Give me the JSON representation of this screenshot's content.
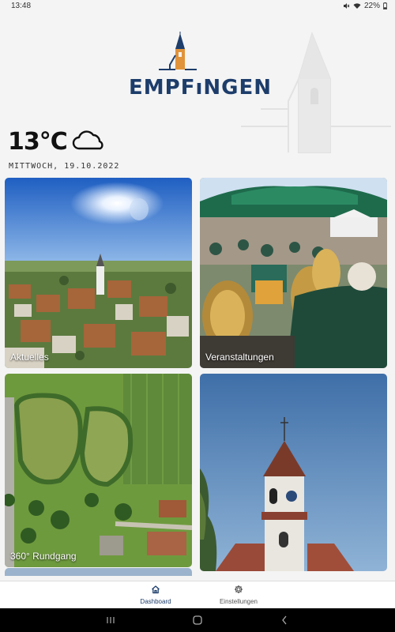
{
  "status_bar": {
    "time": "13:48",
    "battery": "22%",
    "icons": [
      "mute-icon",
      "wifi-icon",
      "battery-icon"
    ]
  },
  "header": {
    "logo_text": "EMPFıNGEN",
    "temperature": "13°C",
    "weather_icon": "cloud-icon",
    "date": "MITTWOCH, 19.10.2022"
  },
  "tiles": [
    {
      "label": "Aktuelles"
    },
    {
      "label": "Veranstaltungen"
    },
    {
      "label": "360° Rundgang"
    },
    {
      "label": ""
    }
  ],
  "bottom_nav": {
    "items": [
      {
        "label": "Dashboard",
        "icon": "home-icon",
        "active": true
      },
      {
        "label": "Einstellungen",
        "icon": "gear-icon",
        "active": false
      }
    ]
  },
  "colors": {
    "brand_blue": "#1d3d6b",
    "brand_orange": "#e0933a",
    "background": "#f4f4f4"
  }
}
